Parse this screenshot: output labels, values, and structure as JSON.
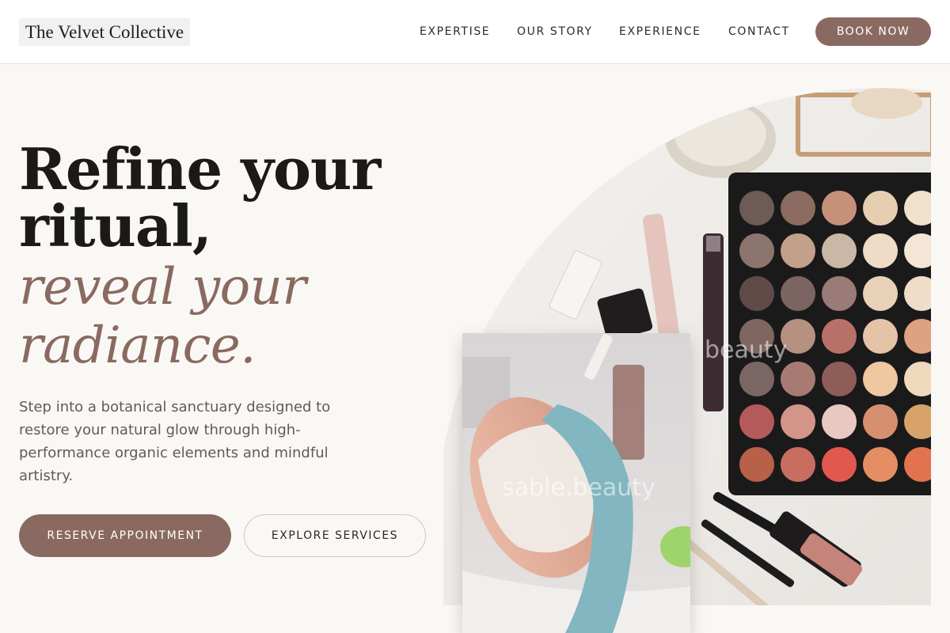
{
  "brand": {
    "name": "The Velvet Collective"
  },
  "nav": {
    "items": [
      {
        "label": "EXPERTISE"
      },
      {
        "label": "OUR STORY"
      },
      {
        "label": "EXPERIENCE"
      },
      {
        "label": "CONTACT"
      }
    ],
    "cta": "BOOK NOW"
  },
  "hero": {
    "headline_lines": [
      "Refine your",
      "ritual,"
    ],
    "accent_lines": [
      "reveal your",
      "radiance."
    ],
    "intro_lines": [
      "Step into a botanical sanctuary designed to",
      "restore your natural glow through high-",
      "performance organic elements and mindful",
      "artistry."
    ],
    "primary_cta": "RESERVE APPOINTMENT",
    "secondary_cta": "EXPLORE SERVICES"
  },
  "images": {
    "watermark_text": "sable.beauty",
    "watermark_partial": "beauty"
  },
  "colors": {
    "accent": "#8a6a60",
    "background": "#faf8f5",
    "header_bg": "#ffffff",
    "text": "#1c1a19",
    "muted_text": "#625a56"
  },
  "icons": [
    "makeup-palette-photo",
    "facial-treatment-photo"
  ]
}
